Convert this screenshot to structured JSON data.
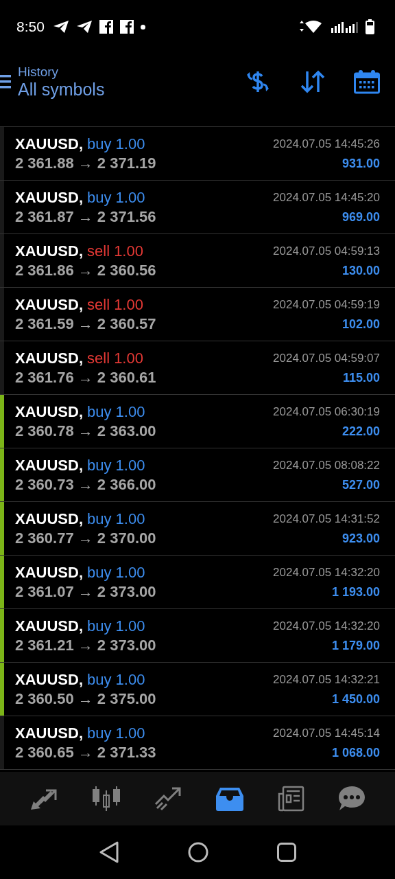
{
  "status_bar": {
    "time": "8:50"
  },
  "header": {
    "subtitle": "History",
    "title": "All symbols"
  },
  "deals": [
    {
      "symbol": "XAUUSD,",
      "kind": "buy",
      "deal": "buy 1.00",
      "prices": "2 361.88 → 2 371.19",
      "time": "2024.07.05 14:45:26",
      "profit": "931.00",
      "highlighted": false
    },
    {
      "symbol": "XAUUSD,",
      "kind": "buy",
      "deal": "buy 1.00",
      "prices": "2 361.87 → 2 371.56",
      "time": "2024.07.05 14:45:20",
      "profit": "969.00",
      "highlighted": false
    },
    {
      "symbol": "XAUUSD,",
      "kind": "sell",
      "deal": "sell 1.00",
      "prices": "2 361.86 → 2 360.56",
      "time": "2024.07.05 04:59:13",
      "profit": "130.00",
      "highlighted": false
    },
    {
      "symbol": "XAUUSD,",
      "kind": "sell",
      "deal": "sell 1.00",
      "prices": "2 361.59 → 2 360.57",
      "time": "2024.07.05 04:59:19",
      "profit": "102.00",
      "highlighted": false
    },
    {
      "symbol": "XAUUSD,",
      "kind": "sell",
      "deal": "sell 1.00",
      "prices": "2 361.76 → 2 360.61",
      "time": "2024.07.05 04:59:07",
      "profit": "115.00",
      "highlighted": false
    },
    {
      "symbol": "XAUUSD,",
      "kind": "buy",
      "deal": "buy 1.00",
      "prices": "2 360.78 → 2 363.00",
      "time": "2024.07.05 06:30:19",
      "profit": "222.00",
      "highlighted": true
    },
    {
      "symbol": "XAUUSD,",
      "kind": "buy",
      "deal": "buy 1.00",
      "prices": "2 360.73 → 2 366.00",
      "time": "2024.07.05 08:08:22",
      "profit": "527.00",
      "highlighted": true
    },
    {
      "symbol": "XAUUSD,",
      "kind": "buy",
      "deal": "buy 1.00",
      "prices": "2 360.77 → 2 370.00",
      "time": "2024.07.05 14:31:52",
      "profit": "923.00",
      "highlighted": true
    },
    {
      "symbol": "XAUUSD,",
      "kind": "buy",
      "deal": "buy 1.00",
      "prices": "2 361.07 → 2 373.00",
      "time": "2024.07.05 14:32:20",
      "profit": "1 193.00",
      "highlighted": true
    },
    {
      "symbol": "XAUUSD,",
      "kind": "buy",
      "deal": "buy 1.00",
      "prices": "2 361.21 → 2 373.00",
      "time": "2024.07.05 14:32:20",
      "profit": "1 179.00",
      "highlighted": true
    },
    {
      "symbol": "XAUUSD,",
      "kind": "buy",
      "deal": "buy 1.00",
      "prices": "2 360.50 → 2 375.00",
      "time": "2024.07.05 14:32:21",
      "profit": "1 450.00",
      "highlighted": true
    },
    {
      "symbol": "XAUUSD,",
      "kind": "buy",
      "deal": "buy 1.00",
      "prices": "2 360.65 → 2 371.33",
      "time": "2024.07.05 14:45:14",
      "profit": "1 068.00",
      "highlighted": false
    }
  ],
  "bottom_tabs": [
    {
      "kind": "quotes",
      "selected": false
    },
    {
      "kind": "chart",
      "selected": false
    },
    {
      "kind": "trade",
      "selected": false
    },
    {
      "kind": "history",
      "selected": true
    },
    {
      "kind": "news",
      "selected": false
    },
    {
      "kind": "chat",
      "selected": false
    }
  ]
}
